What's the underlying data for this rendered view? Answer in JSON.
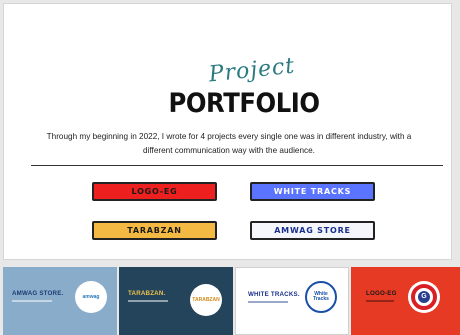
{
  "slide": {
    "script_title": "Project",
    "title": "PORTFOLIO",
    "description": "Through my beginning in 2022, I wrote for 4 projects every single one was in different industry, with a different communication way with the audience.",
    "buttons": {
      "logo_eg": "LOGO-EG",
      "white_tracks": "WHITE TRACKS",
      "tarabzan": "TARABZAN",
      "amwag_store": "AMWAG STORE"
    }
  },
  "thumbnails": [
    {
      "title": "AMWAG STORE.",
      "logo_text": "amwag"
    },
    {
      "title": "TARABZAN.",
      "logo_text": "TARABZAN"
    },
    {
      "title": "WHITE TRACKS.",
      "logo_text": "White Tracks"
    },
    {
      "title": "LOGO-EG",
      "logo_text": "G"
    }
  ],
  "colors": {
    "logo_eg": "#ee1f1f",
    "white_tracks": "#5b74ff",
    "tarabzan": "#f4b942",
    "amwag_store": "#f4f6fb",
    "accent_script": "#2a7a80"
  }
}
